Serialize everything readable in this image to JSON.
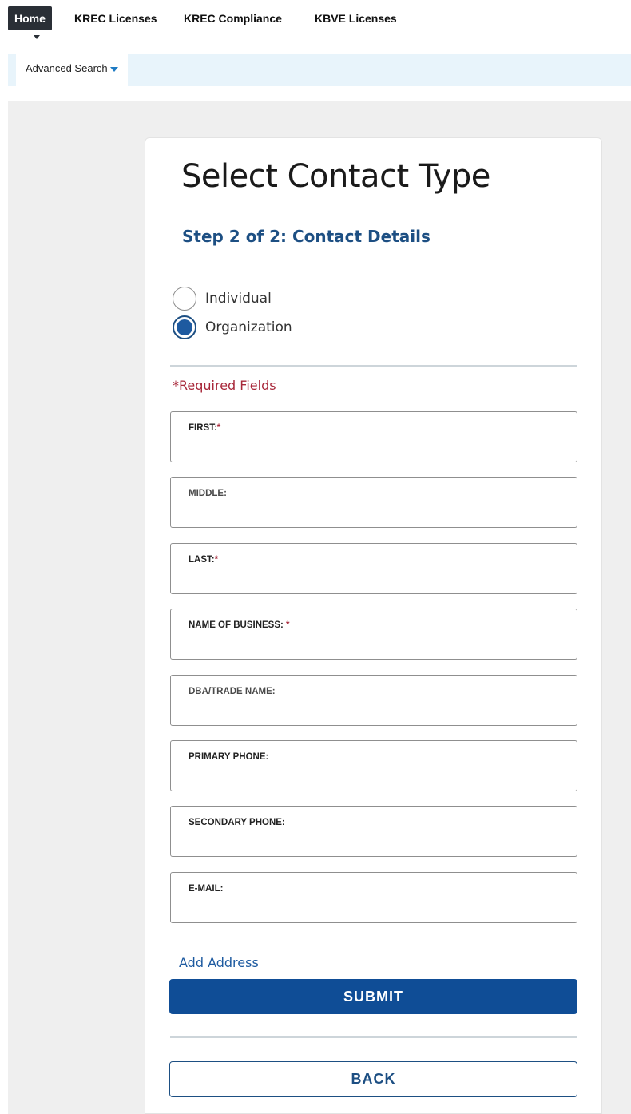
{
  "nav": {
    "items": [
      "Home",
      "KREC Licenses",
      "KREC Compliance",
      "KBVE Licenses"
    ],
    "active": "Home",
    "subnav_tab": "Advanced Search"
  },
  "form": {
    "title": "Select Contact Type",
    "step": "Step 2 of 2: Contact Details",
    "contact_types": [
      {
        "label": "Individual",
        "checked": false
      },
      {
        "label": "Organization",
        "checked": true
      }
    ],
    "required_note": "Required Fields",
    "required_marker": "*",
    "fields": [
      {
        "label": "FIRST:",
        "required": true,
        "value": ""
      },
      {
        "label": "MIDDLE:",
        "required": false,
        "value": ""
      },
      {
        "label": "LAST:",
        "required": true,
        "value": ""
      },
      {
        "label": "NAME OF BUSINESS:",
        "required": true,
        "value": ""
      },
      {
        "label": "DBA/TRADE NAME:",
        "required": false,
        "value": ""
      },
      {
        "label": "PRIMARY PHONE:",
        "required": false,
        "value": ""
      },
      {
        "label": "SECONDARY PHONE:",
        "required": false,
        "value": ""
      },
      {
        "label": "E-MAIL:",
        "required": false,
        "value": ""
      }
    ],
    "add_address_label": "Add Address",
    "submit_label": "SUBMIT",
    "back_label": "BACK"
  },
  "colors": {
    "accent": "#0f4d96",
    "heading_blue": "#1d4f83",
    "required_red": "#a8283a",
    "nav_active_bg": "#2a2f36",
    "subnav_bg": "#e8f4fb",
    "page_bg": "#efefef"
  },
  "icons": {
    "subnav_caret": "caret-down-icon",
    "nav_caret": "caret-down-icon"
  }
}
